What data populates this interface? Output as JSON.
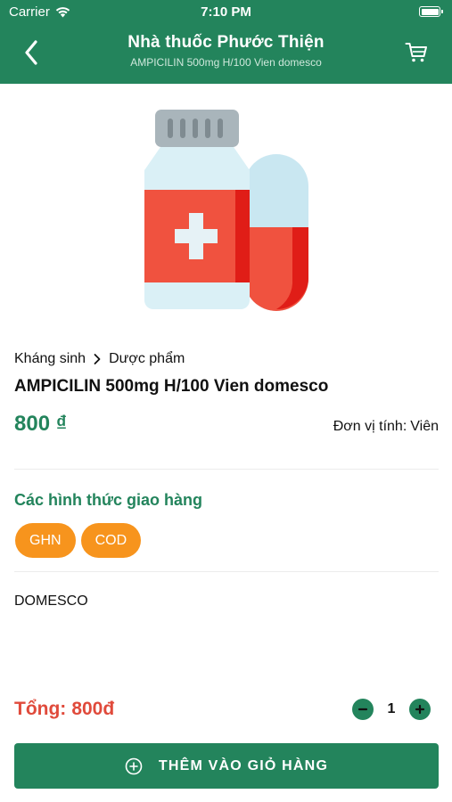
{
  "status_bar": {
    "carrier": "Carrier",
    "time": "7:10 PM"
  },
  "header": {
    "title": "Nhà thuốc Phước Thiện",
    "subtitle": "AMPICILIN 500mg H/100 Vien domesco",
    "back_icon": "chevron-left-icon",
    "cart_icon": "shopping-cart-icon"
  },
  "product": {
    "image_icon": "medicine-bottle-pill-icon",
    "breadcrumb": [
      "Kháng sinh",
      "Dược phẩm"
    ],
    "name": "AMPICILIN 500mg H/100 Vien domesco",
    "price": "800 ₫",
    "unit_label": "Đơn vị tính:",
    "unit_value": "Viên"
  },
  "shipping": {
    "title": "Các hình thức giao hàng",
    "methods": [
      "GHN",
      "COD"
    ]
  },
  "manufacturer": "DOMESCO",
  "footer": {
    "total_label": "Tổng:",
    "total_value": "800đ",
    "quantity": "1",
    "add_to_cart": "THÊM VÀO GIỎ HÀNG"
  },
  "colors": {
    "primary": "#23845c",
    "accent": "#f7941d",
    "total": "#e04a3b",
    "medicine_red": "#f0523f",
    "bottle_cap": "#a9b5bb",
    "bottle_body": "#daf0f6"
  }
}
